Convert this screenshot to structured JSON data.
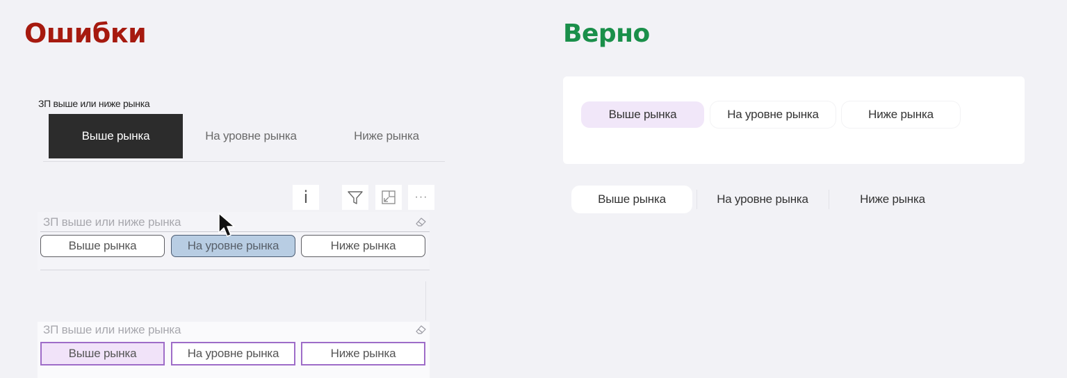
{
  "headings": {
    "errors": "Ошибки",
    "correct": "Верно"
  },
  "slicer_dark": {
    "title": "ЗП выше или ниже рынка",
    "options": [
      "Выше рынка",
      "На уровне рынка",
      "Ниже рынка"
    ],
    "selected": "Выше рынка"
  },
  "toolbar": {
    "info_glyph": "i",
    "more_glyph": "···",
    "icons": [
      "info-icon",
      "filter-icon",
      "focus-mode-icon",
      "more-options-icon"
    ]
  },
  "slicer_blue": {
    "title": "ЗП выше или ниже рынка",
    "options": [
      "Выше рынка",
      "На уровне рынка",
      "Ниже рынка"
    ],
    "selected": "На уровне рынка"
  },
  "slicer_purple": {
    "title": "ЗП выше или ниже рынка",
    "options": [
      "Выше рынка",
      "На уровне рынка",
      "Ниже рынка"
    ],
    "selected": "Выше рынка"
  },
  "correct_card": {
    "options": [
      "Выше рынка",
      "На уровне рынка",
      "Ниже рынка"
    ],
    "selected": "Выше рынка"
  },
  "correct_plain": {
    "options": [
      "Выше рынка",
      "На уровне рынка",
      "Ниже рынка"
    ],
    "selected": "Выше рынка"
  },
  "colors": {
    "errors_heading": "#a61a0f",
    "correct_heading": "#1a8f4a",
    "dark_selected": "#2c2c2c",
    "blue_selected": "#b8cde3",
    "purple_border": "#9e6cc8",
    "purple_selected": "#f1e3f9",
    "correct_selected": "#f1e7f9"
  }
}
